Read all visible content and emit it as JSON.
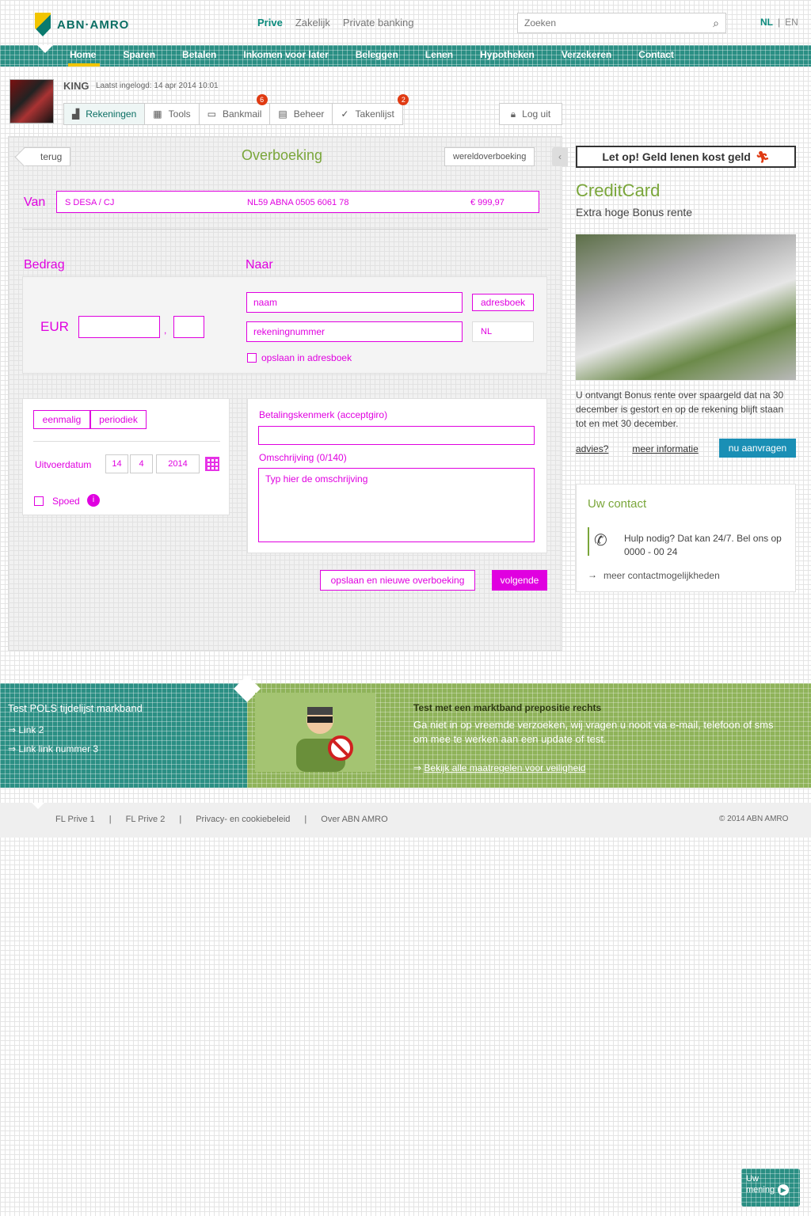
{
  "header": {
    "logo_text": "ABN·AMRO",
    "topnav": [
      "Prive",
      "Zakelijk",
      "Private banking"
    ],
    "search_placeholder": "Zoeken",
    "lang_nl": "NL",
    "lang_sep": "|",
    "lang_en": "EN"
  },
  "mainnav": [
    "Home",
    "Sparen",
    "Betalen",
    "Inkomen voor later",
    "Beleggen",
    "Lenen",
    "Hypotheken",
    "Verzekeren",
    "Contact"
  ],
  "user": {
    "name": "KING",
    "last_login": "Laatst ingelogd: 14 apr 2014 10:01"
  },
  "tabs": [
    {
      "label": "Rekeningen",
      "icon": "bar-chart-icon",
      "active": true
    },
    {
      "label": "Tools",
      "icon": "grid-icon"
    },
    {
      "label": "Bankmail",
      "icon": "mail-icon",
      "badge": "6"
    },
    {
      "label": "Beheer",
      "icon": "settings-icon"
    },
    {
      "label": "Takenlijst",
      "icon": "check-icon",
      "badge": "2"
    }
  ],
  "logout": "Log uit",
  "transfer": {
    "back": "terug",
    "title": "Overboeking",
    "intl": "wereldoverboeking",
    "van_label": "Van",
    "van_name": "S DESA / CJ",
    "van_iban": "NL59 ABNA 0505 6061 78",
    "van_balance": "€ 999,97",
    "bedrag_label": "Bedrag",
    "naar_label": "Naar",
    "currency": "EUR",
    "comma": ",",
    "naam_placeholder": "naam",
    "adresboek": "adresboek",
    "rek_placeholder": "rekeningnummer",
    "country": "NL",
    "save_addr": "opslaan in adresboek",
    "eenmalig": "eenmalig",
    "periodiek": "periodiek",
    "uitvoer_label": "Uitvoerdatum",
    "day": "14",
    "month": "4",
    "year": "2014",
    "spoed": "Spoed",
    "betaling_label": "Betalingskenmerk (acceptgiro)",
    "omschr_label": "Omschrijving (0/140)",
    "omschr_placeholder": "Typ hier de omschrijving",
    "save_new": "opslaan en nieuwe overboeking",
    "submit": "volgende"
  },
  "sidebar": {
    "banner": "Let op! Geld lenen kost geld",
    "cc_title": "CreditCard",
    "cc_sub": "Extra hoge Bonus rente",
    "promo": "U ontvangt Bonus rente over spaargeld dat na 30 december is gestort en op de rekening blijft staan tot en met 30 december.",
    "advies": "advies?",
    "meer_info": "meer informatie",
    "apply": "nu aanvragen",
    "contact_title": "Uw contact",
    "contact_text": "Hulp nodig? Dat kan 24/7. Bel ons op 0000 - 00 24",
    "contact_link": "meer contactmogelijkheden"
  },
  "band": {
    "teal_title": "Test POLS tijdelijst markband",
    "teal_link1": "Link 2",
    "teal_link2": "Link link nummer 3",
    "green_title": "Test met een marktband prepositie rechts",
    "green_text": "Ga niet in op vreemde verzoeken, wij vragen u nooit via e-mail, telefoon of sms om mee te werken aan een update of test.",
    "green_link": "Bekijk alle maatregelen voor veiligheid"
  },
  "footer": {
    "links": [
      "FL Prive 1",
      "FL Prive 2",
      "Privacy- en cookiebeleid",
      "Over ABN AMRO"
    ],
    "copyright": "© 2014 ABN AMRO"
  },
  "feedback": {
    "line1": "Uw",
    "line2": "mening"
  },
  "colors": {
    "brand_teal": "#0a8a7c",
    "brand_green": "#7aa63a",
    "accent_magenta": "#e000e0",
    "brand_yellow": "#f2c500"
  }
}
